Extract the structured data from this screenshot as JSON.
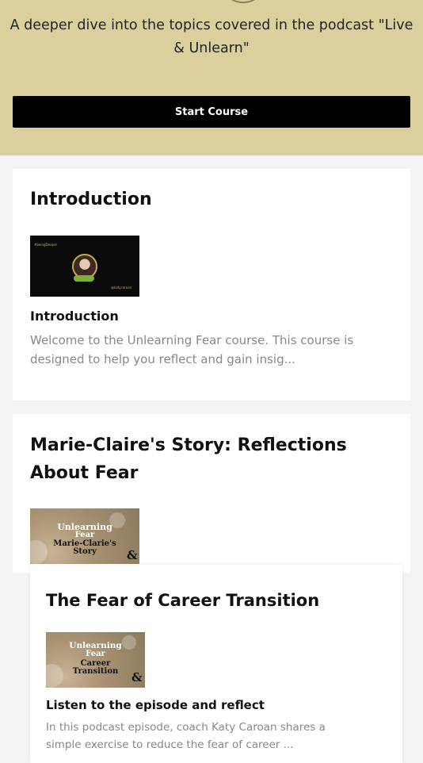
{
  "course": {
    "description": "A deeper dive into the topics covered in the podcast \"Live & Unlearn\"",
    "start_label": "Start Course"
  },
  "sections": [
    {
      "title": "Introduction",
      "lesson": {
        "title": "Introduction",
        "description": "Welcome to the Unlearning Fear course. This course is designed to help you reflect and gain insig...",
        "thumb_tag": "#beingDeeper",
        "thumb_handle": "@katycaroan"
      }
    },
    {
      "title": "Marie-Claire's Story: Reflections About Fear",
      "lesson": {
        "thumb_line1": "Unlearning",
        "thumb_line2": "Fear",
        "thumb_line3": "Marie-Clarie's",
        "thumb_line4": "Story"
      }
    },
    {
      "title": "The Fear of Career Transition",
      "lesson": {
        "title": "Listen to the episode and reflect",
        "description": "In this podcast episode, coach Katy Caroan shares a simple exercise to reduce the fear of career ...",
        "thumb_line1": "Unlearning",
        "thumb_line2": "Fear",
        "thumb_line3": "Career",
        "thumb_line4": "Transition"
      }
    }
  ],
  "colors": {
    "hero_bg": "#dccf9e",
    "button_bg": "#000000",
    "page_bg": "#f4f4f4",
    "muted_text": "#888888"
  }
}
